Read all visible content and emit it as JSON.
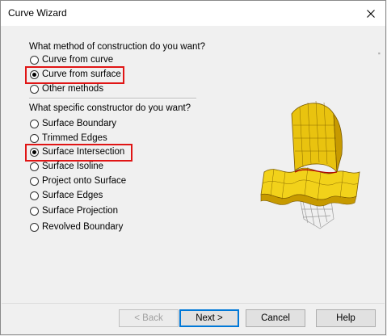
{
  "window": {
    "title": "Curve Wizard",
    "close_glyph": "✕"
  },
  "method_section": {
    "prompt": "What method of construction do you want?",
    "options": [
      {
        "label": "Curve from curve",
        "selected": false
      },
      {
        "label": "Curve from surface",
        "selected": true
      },
      {
        "label": "Other methods",
        "selected": false
      }
    ]
  },
  "constructor_section": {
    "prompt": "What specific constructor do you want?",
    "options": [
      {
        "label": "Surface Boundary",
        "selected": false
      },
      {
        "label": "Trimmed Edges",
        "selected": false
      },
      {
        "label": "Surface Intersection",
        "selected": true
      },
      {
        "label": "Surface Isoline",
        "selected": false
      },
      {
        "label": "Project onto Surface",
        "selected": false
      },
      {
        "label": "Surface Edges",
        "selected": false
      },
      {
        "label": "Surface Projection",
        "selected": false
      },
      {
        "label": "Revolved Boundary",
        "selected": false
      }
    ]
  },
  "buttons": {
    "back": "< Back",
    "next": "Next >",
    "cancel": "Cancel",
    "help": "Help"
  },
  "colors": {
    "highlight": "#e01515",
    "surface_yellow": "#f2d21a",
    "surface_shadow": "#c79a00",
    "accent": "#0078d7"
  },
  "icons": {
    "illustration": "intersecting-surfaces-illustration",
    "close": "close-icon"
  }
}
